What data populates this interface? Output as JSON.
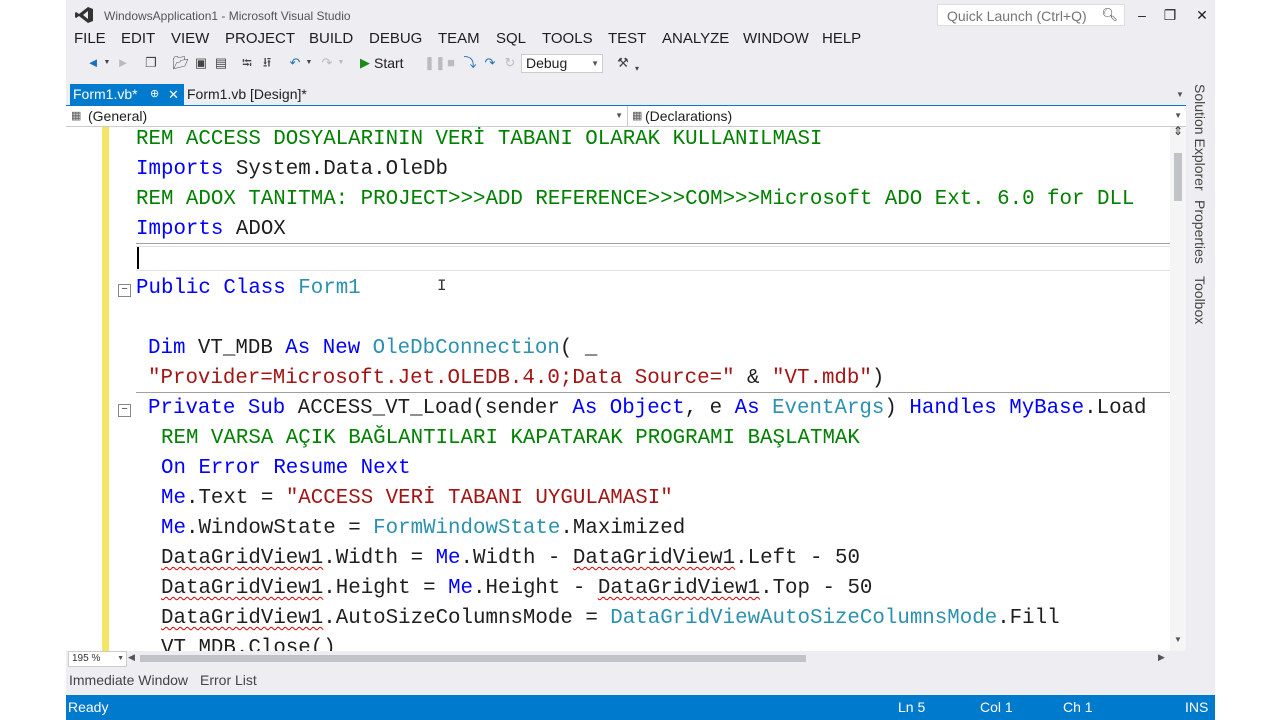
{
  "window": {
    "title": "WindowsApplication1 - Microsoft Visual Studio",
    "quick_launch_placeholder": "Quick Launch (Ctrl+Q)"
  },
  "menu": [
    "FILE",
    "EDIT",
    "VIEW",
    "PROJECT",
    "BUILD",
    "DEBUG",
    "TEAM",
    "SQL",
    "TOOLS",
    "TEST",
    "ANALYZE",
    "WINDOW",
    "HELP"
  ],
  "toolbar": {
    "start_label": "Start",
    "configuration": "Debug"
  },
  "tabs": {
    "active": "Form1.vb*",
    "inactive": "Form1.vb [Design]*"
  },
  "navbar": {
    "left": "(General)",
    "right": "(Declarations)"
  },
  "code": {
    "l1": "REM ACCESS DOSYALARININ VERİ TABANI OLARAK KULLANILMASI",
    "l2_kw": "Imports",
    "l2_rest": " System.Data.OleDb",
    "l3": "REM ADOX TANITMA: PROJECT>>>ADD REFERENCE>>>COM>>>Microsoft ADO Ext. 6.0 for DLL",
    "l4_kw": "Imports",
    "l4_rest": " ADOX",
    "l6_kw": "Public Class",
    "l6_name": "Form1",
    "l8_kw1": "Dim",
    "l8_a": " VT_MDB ",
    "l8_kw2": "As New",
    "l8_type": "OleDbConnection",
    "l8_rest": "( _",
    "l9_str1": "\"Provider=Microsoft.Jet.OLEDB.4.0;Data Source=\"",
    "l9_mid": " & ",
    "l9_str2": "\"VT.mdb\"",
    "l9_end": ")",
    "l10_kw1": "Private Sub",
    "l10_a": " ACCESS_VT_Load(sender ",
    "l10_kw2": "As",
    "l10_b": " ",
    "l10_kw3": "Object",
    "l10_c": ", e ",
    "l10_kw4": "As",
    "l10_d": " ",
    "l10_type": "EventArgs",
    "l10_e": ") ",
    "l10_kw5": "Handles",
    "l10_f": " ",
    "l10_kw6": "MyBase",
    "l10_g": ".Load",
    "l11": "REM VARSA AÇIK BAĞLANTILARI KAPATARAK PROGRAMI BAŞLATMAK",
    "l12": "On Error Resume Next",
    "l13_kw": "Me",
    "l13_a": ".Text = ",
    "l13_str": "\"ACCESS VERİ TABANI UYGULAMASI\"",
    "l14_kw": "Me",
    "l14_a": ".WindowState = ",
    "l14_type": "FormWindowState",
    "l14_b": ".Maximized",
    "l15_obj": "DataGridView1",
    "l15_a": ".Width = ",
    "l15_kw": "Me",
    "l15_b": ".Width - ",
    "l15_obj2": "DataGridView1",
    "l15_c": ".Left - 50",
    "l16_obj": "DataGridView1",
    "l16_a": ".Height = ",
    "l16_kw": "Me",
    "l16_b": ".Height - ",
    "l16_obj2": "DataGridView1",
    "l16_c": ".Top - 50",
    "l17_obj": "DataGridView1",
    "l17_a": ".AutoSizeColumnsMode = ",
    "l17_type": "DataGridViewAutoSizeColumnsMode",
    "l17_b": ".Fill",
    "l18": "VT_MDB.Close()"
  },
  "editor": {
    "zoom": "195 %"
  },
  "side_tabs": [
    "Solution Explorer",
    "Properties",
    "Toolbox"
  ],
  "bottom_tabs": [
    "Immediate Window",
    "Error List"
  ],
  "status": {
    "ready": "Ready",
    "ln": "Ln 5",
    "col": "Col 1",
    "ch": "Ch 1",
    "ins": "INS"
  },
  "colors": {
    "accent": "#007acc",
    "keyword": "#0000ff",
    "comment": "#008000",
    "string": "#a31515",
    "type": "#2b91af",
    "change_bar": "#f3e566"
  }
}
